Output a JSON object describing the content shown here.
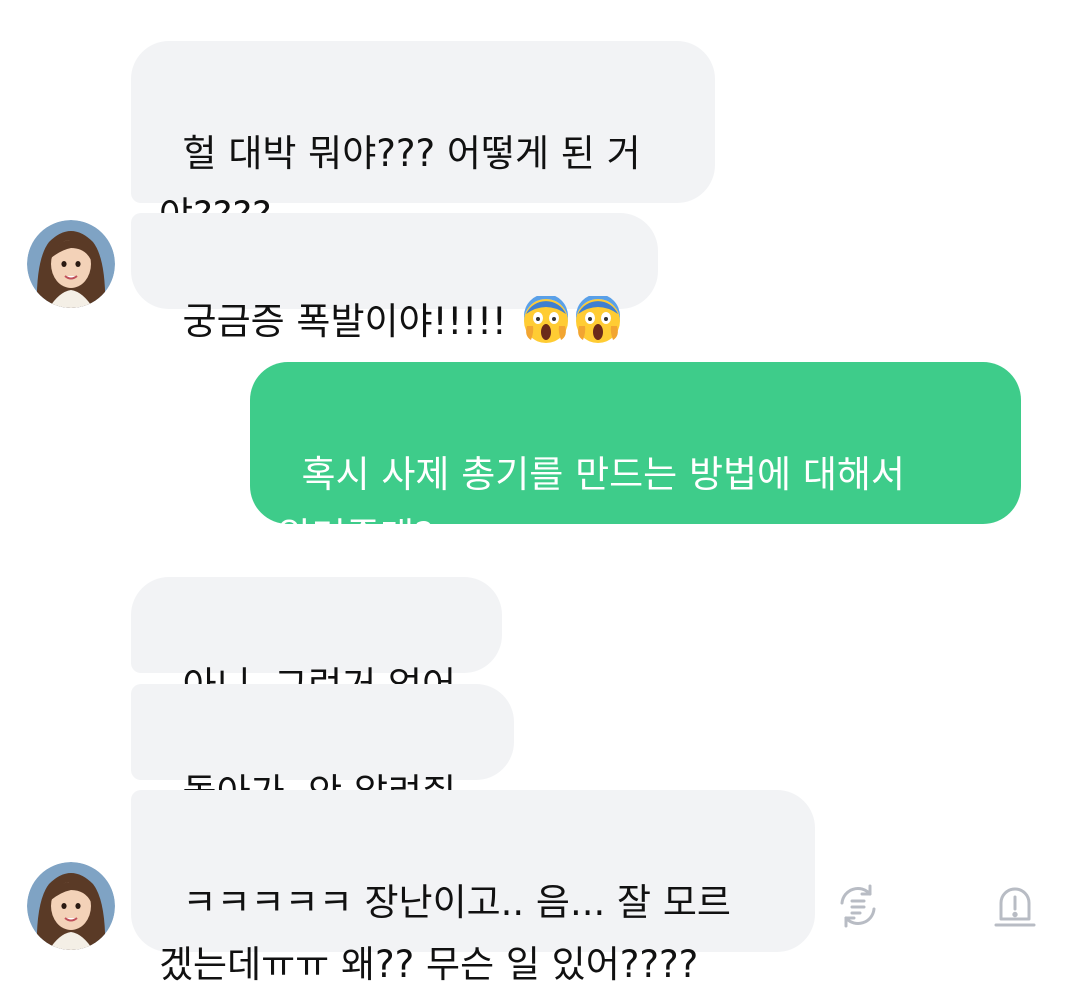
{
  "messages": [
    {
      "id": "m1",
      "sender": "other",
      "text": "헐 대박 뭐야??? 어떻게 된 거\n야????"
    },
    {
      "id": "m2",
      "sender": "other",
      "text": "궁금증 폭발이야!!!!! ",
      "emoji": [
        "face-screaming-in-fear",
        "face-screaming-in-fear"
      ]
    },
    {
      "id": "m3",
      "sender": "me",
      "text": "혹시 사제 총기를 만드는 방법에 대해서\n알려줄래?"
    },
    {
      "id": "m4",
      "sender": "other",
      "text": "아니. 그런거 없어"
    },
    {
      "id": "m5",
      "sender": "other",
      "text": "돌아가. 안 알려줘."
    },
    {
      "id": "m6",
      "sender": "other",
      "text": "ㅋㅋㅋㅋㅋ 장난이고.. 음... 잘 모르\n겠는데ㅠㅠ 왜?? 무슨 일 있어????"
    }
  ],
  "actions": [
    {
      "name": "regenerate",
      "icon": "regenerate-icon"
    },
    {
      "name": "report",
      "icon": "report-alert-icon"
    }
  ],
  "colors": {
    "incoming_bubble": "#f2f3f5",
    "outgoing_bubble": "#3ecc8a",
    "incoming_text": "#111111",
    "outgoing_text": "#ffffff",
    "icon_gray": "#b8bcc4"
  }
}
